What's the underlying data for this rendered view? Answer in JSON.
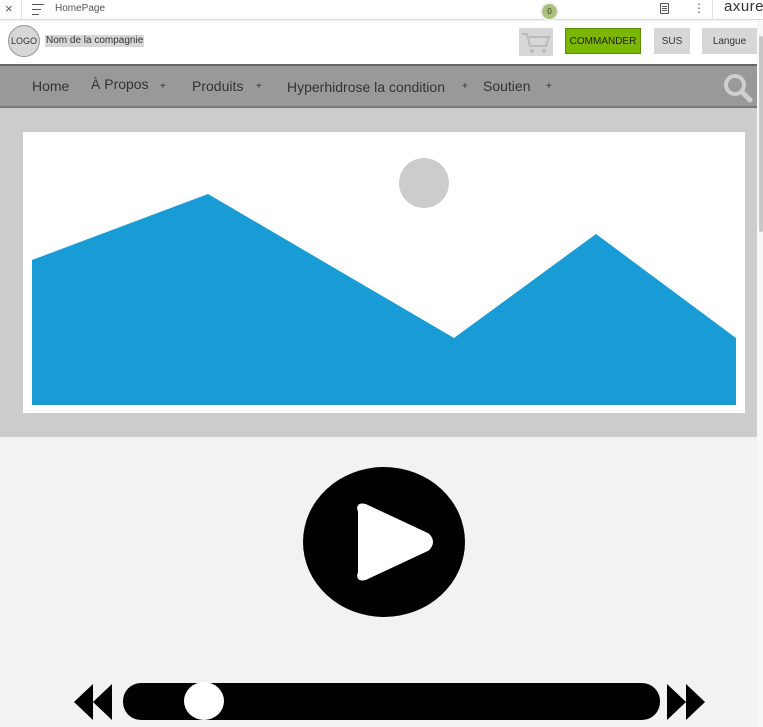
{
  "axure_bar": {
    "close": "×",
    "page_title": "HomePage",
    "more": "⋮",
    "brand": "axure"
  },
  "header": {
    "logo": "LOGO",
    "company_name": "Nom de la compagnie",
    "cart_count": "0",
    "order_button": "COMMANDER",
    "sus_button": "SUS",
    "language_button": "Langue"
  },
  "nav": {
    "items": [
      {
        "label": "Home",
        "plus": ""
      },
      {
        "label": "À Propos",
        "plus": "+"
      },
      {
        "label": "Produits",
        "plus": "+"
      },
      {
        "label": "Hyperhidrose la condition",
        "plus": "+"
      },
      {
        "label": "Soutien",
        "plus": "+"
      }
    ]
  },
  "video": {
    "progress": 0.15
  },
  "colors": {
    "accent_green": "#7bb600",
    "image_blue": "#199bd6",
    "nav_gray": "#999999"
  },
  "icons": [
    "close-icon",
    "menu-icon",
    "notes-icon",
    "more-icon",
    "cart-icon",
    "search-icon",
    "image-placeholder-icon",
    "play-icon",
    "rewind-icon",
    "fast-forward-icon"
  ]
}
